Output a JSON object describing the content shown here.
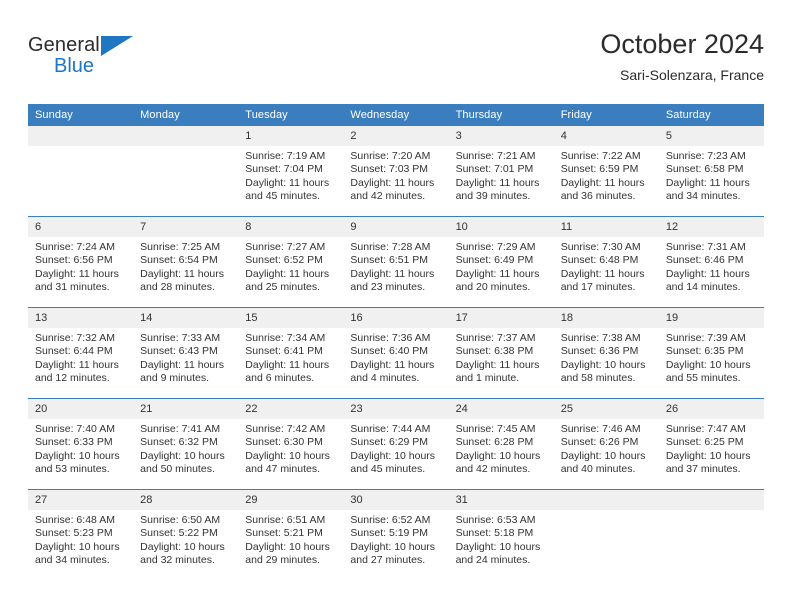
{
  "logo": {
    "text_top": "General",
    "text_bottom": "Blue",
    "accent_color": "#1f76c2"
  },
  "header": {
    "title": "October 2024",
    "subtitle": "Sari-Solenzara, France"
  },
  "theme": {
    "header_blue": "#3a7ebf",
    "daynum_bg": "#f0f0f0"
  },
  "calendar": {
    "weekday_headers": [
      "Sunday",
      "Monday",
      "Tuesday",
      "Wednesday",
      "Thursday",
      "Friday",
      "Saturday"
    ],
    "weeks": [
      [
        {
          "day": ""
        },
        {
          "day": ""
        },
        {
          "day": "1",
          "sunrise": "Sunrise: 7:19 AM",
          "sunset": "Sunset: 7:04 PM",
          "daylight_line1": "Daylight: 11 hours",
          "daylight_line2": "and 45 minutes."
        },
        {
          "day": "2",
          "sunrise": "Sunrise: 7:20 AM",
          "sunset": "Sunset: 7:03 PM",
          "daylight_line1": "Daylight: 11 hours",
          "daylight_line2": "and 42 minutes."
        },
        {
          "day": "3",
          "sunrise": "Sunrise: 7:21 AM",
          "sunset": "Sunset: 7:01 PM",
          "daylight_line1": "Daylight: 11 hours",
          "daylight_line2": "and 39 minutes."
        },
        {
          "day": "4",
          "sunrise": "Sunrise: 7:22 AM",
          "sunset": "Sunset: 6:59 PM",
          "daylight_line1": "Daylight: 11 hours",
          "daylight_line2": "and 36 minutes."
        },
        {
          "day": "5",
          "sunrise": "Sunrise: 7:23 AM",
          "sunset": "Sunset: 6:58 PM",
          "daylight_line1": "Daylight: 11 hours",
          "daylight_line2": "and 34 minutes."
        }
      ],
      [
        {
          "day": "6",
          "sunrise": "Sunrise: 7:24 AM",
          "sunset": "Sunset: 6:56 PM",
          "daylight_line1": "Daylight: 11 hours",
          "daylight_line2": "and 31 minutes."
        },
        {
          "day": "7",
          "sunrise": "Sunrise: 7:25 AM",
          "sunset": "Sunset: 6:54 PM",
          "daylight_line1": "Daylight: 11 hours",
          "daylight_line2": "and 28 minutes."
        },
        {
          "day": "8",
          "sunrise": "Sunrise: 7:27 AM",
          "sunset": "Sunset: 6:52 PM",
          "daylight_line1": "Daylight: 11 hours",
          "daylight_line2": "and 25 minutes."
        },
        {
          "day": "9",
          "sunrise": "Sunrise: 7:28 AM",
          "sunset": "Sunset: 6:51 PM",
          "daylight_line1": "Daylight: 11 hours",
          "daylight_line2": "and 23 minutes."
        },
        {
          "day": "10",
          "sunrise": "Sunrise: 7:29 AM",
          "sunset": "Sunset: 6:49 PM",
          "daylight_line1": "Daylight: 11 hours",
          "daylight_line2": "and 20 minutes."
        },
        {
          "day": "11",
          "sunrise": "Sunrise: 7:30 AM",
          "sunset": "Sunset: 6:48 PM",
          "daylight_line1": "Daylight: 11 hours",
          "daylight_line2": "and 17 minutes."
        },
        {
          "day": "12",
          "sunrise": "Sunrise: 7:31 AM",
          "sunset": "Sunset: 6:46 PM",
          "daylight_line1": "Daylight: 11 hours",
          "daylight_line2": "and 14 minutes."
        }
      ],
      [
        {
          "day": "13",
          "sunrise": "Sunrise: 7:32 AM",
          "sunset": "Sunset: 6:44 PM",
          "daylight_line1": "Daylight: 11 hours",
          "daylight_line2": "and 12 minutes."
        },
        {
          "day": "14",
          "sunrise": "Sunrise: 7:33 AM",
          "sunset": "Sunset: 6:43 PM",
          "daylight_line1": "Daylight: 11 hours",
          "daylight_line2": "and 9 minutes."
        },
        {
          "day": "15",
          "sunrise": "Sunrise: 7:34 AM",
          "sunset": "Sunset: 6:41 PM",
          "daylight_line1": "Daylight: 11 hours",
          "daylight_line2": "and 6 minutes."
        },
        {
          "day": "16",
          "sunrise": "Sunrise: 7:36 AM",
          "sunset": "Sunset: 6:40 PM",
          "daylight_line1": "Daylight: 11 hours",
          "daylight_line2": "and 4 minutes."
        },
        {
          "day": "17",
          "sunrise": "Sunrise: 7:37 AM",
          "sunset": "Sunset: 6:38 PM",
          "daylight_line1": "Daylight: 11 hours",
          "daylight_line2": "and 1 minute."
        },
        {
          "day": "18",
          "sunrise": "Sunrise: 7:38 AM",
          "sunset": "Sunset: 6:36 PM",
          "daylight_line1": "Daylight: 10 hours",
          "daylight_line2": "and 58 minutes."
        },
        {
          "day": "19",
          "sunrise": "Sunrise: 7:39 AM",
          "sunset": "Sunset: 6:35 PM",
          "daylight_line1": "Daylight: 10 hours",
          "daylight_line2": "and 55 minutes."
        }
      ],
      [
        {
          "day": "20",
          "sunrise": "Sunrise: 7:40 AM",
          "sunset": "Sunset: 6:33 PM",
          "daylight_line1": "Daylight: 10 hours",
          "daylight_line2": "and 53 minutes."
        },
        {
          "day": "21",
          "sunrise": "Sunrise: 7:41 AM",
          "sunset": "Sunset: 6:32 PM",
          "daylight_line1": "Daylight: 10 hours",
          "daylight_line2": "and 50 minutes."
        },
        {
          "day": "22",
          "sunrise": "Sunrise: 7:42 AM",
          "sunset": "Sunset: 6:30 PM",
          "daylight_line1": "Daylight: 10 hours",
          "daylight_line2": "and 47 minutes."
        },
        {
          "day": "23",
          "sunrise": "Sunrise: 7:44 AM",
          "sunset": "Sunset: 6:29 PM",
          "daylight_line1": "Daylight: 10 hours",
          "daylight_line2": "and 45 minutes."
        },
        {
          "day": "24",
          "sunrise": "Sunrise: 7:45 AM",
          "sunset": "Sunset: 6:28 PM",
          "daylight_line1": "Daylight: 10 hours",
          "daylight_line2": "and 42 minutes."
        },
        {
          "day": "25",
          "sunrise": "Sunrise: 7:46 AM",
          "sunset": "Sunset: 6:26 PM",
          "daylight_line1": "Daylight: 10 hours",
          "daylight_line2": "and 40 minutes."
        },
        {
          "day": "26",
          "sunrise": "Sunrise: 7:47 AM",
          "sunset": "Sunset: 6:25 PM",
          "daylight_line1": "Daylight: 10 hours",
          "daylight_line2": "and 37 minutes."
        }
      ],
      [
        {
          "day": "27",
          "sunrise": "Sunrise: 6:48 AM",
          "sunset": "Sunset: 5:23 PM",
          "daylight_line1": "Daylight: 10 hours",
          "daylight_line2": "and 34 minutes."
        },
        {
          "day": "28",
          "sunrise": "Sunrise: 6:50 AM",
          "sunset": "Sunset: 5:22 PM",
          "daylight_line1": "Daylight: 10 hours",
          "daylight_line2": "and 32 minutes."
        },
        {
          "day": "29",
          "sunrise": "Sunrise: 6:51 AM",
          "sunset": "Sunset: 5:21 PM",
          "daylight_line1": "Daylight: 10 hours",
          "daylight_line2": "and 29 minutes."
        },
        {
          "day": "30",
          "sunrise": "Sunrise: 6:52 AM",
          "sunset": "Sunset: 5:19 PM",
          "daylight_line1": "Daylight: 10 hours",
          "daylight_line2": "and 27 minutes."
        },
        {
          "day": "31",
          "sunrise": "Sunrise: 6:53 AM",
          "sunset": "Sunset: 5:18 PM",
          "daylight_line1": "Daylight: 10 hours",
          "daylight_line2": "and 24 minutes."
        },
        {
          "day": ""
        },
        {
          "day": ""
        }
      ]
    ]
  }
}
